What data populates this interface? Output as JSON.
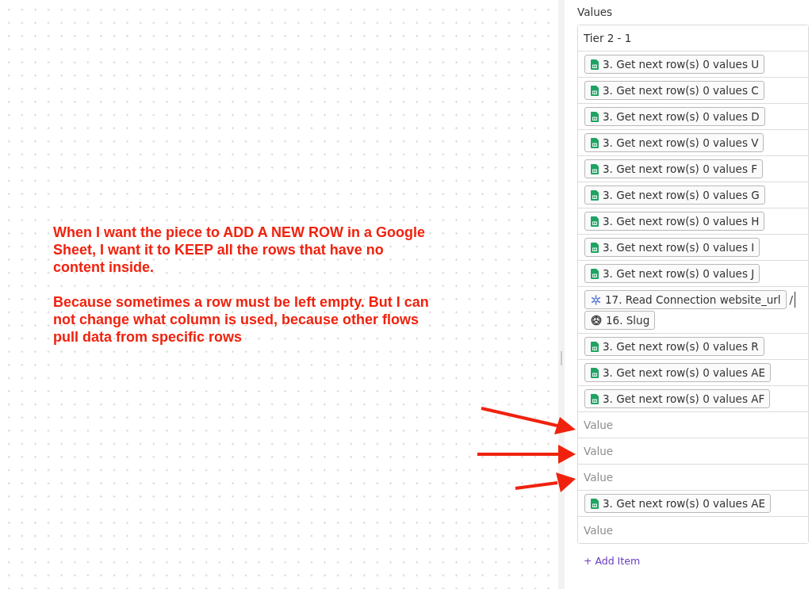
{
  "canvas": {
    "annotation": [
      "When I want the piece to ADD A NEW ROW in a Google Sheet, I want it to KEEP all the rows that have no content inside.",
      "Because sometimes a row must be left empty. But I can not change what column is used, because other flows pull data from specific rows"
    ]
  },
  "panel": {
    "label": "Values",
    "items": [
      {
        "kind": "text",
        "value": "Tier 2 - 1"
      },
      {
        "kind": "chips",
        "parts": [
          {
            "kind": "sheets",
            "text": "3. Get next row(s) 0 values U"
          }
        ]
      },
      {
        "kind": "chips",
        "parts": [
          {
            "kind": "sheets",
            "text": "3. Get next row(s) 0 values C"
          }
        ]
      },
      {
        "kind": "chips",
        "parts": [
          {
            "kind": "sheets",
            "text": "3. Get next row(s) 0 values D"
          }
        ]
      },
      {
        "kind": "chips",
        "parts": [
          {
            "kind": "sheets",
            "text": "3. Get next row(s) 0 values V"
          }
        ]
      },
      {
        "kind": "chips",
        "parts": [
          {
            "kind": "sheets",
            "text": "3. Get next row(s) 0 values F"
          }
        ]
      },
      {
        "kind": "chips",
        "parts": [
          {
            "kind": "sheets",
            "text": "3. Get next row(s) 0 values G"
          }
        ]
      },
      {
        "kind": "chips",
        "parts": [
          {
            "kind": "sheets",
            "text": "3. Get next row(s) 0 values H"
          }
        ]
      },
      {
        "kind": "chips",
        "parts": [
          {
            "kind": "sheets",
            "text": "3. Get next row(s) 0 values I"
          }
        ]
      },
      {
        "kind": "chips",
        "parts": [
          {
            "kind": "sheets",
            "text": "3. Get next row(s) 0 values J"
          }
        ]
      },
      {
        "kind": "chips",
        "parts": [
          {
            "kind": "connection",
            "text": "17. Read Connection website_url"
          },
          {
            "kind": "text",
            "text": "/"
          },
          {
            "kind": "ai",
            "text": "16. Slug"
          }
        ]
      },
      {
        "kind": "chips",
        "parts": [
          {
            "kind": "sheets",
            "text": "3. Get next row(s) 0 values R"
          }
        ]
      },
      {
        "kind": "chips",
        "parts": [
          {
            "kind": "sheets",
            "text": "3. Get next row(s) 0 values AE"
          }
        ]
      },
      {
        "kind": "chips",
        "parts": [
          {
            "kind": "sheets",
            "text": "3. Get next row(s) 0 values AF"
          }
        ]
      },
      {
        "kind": "empty",
        "placeholder": "Value"
      },
      {
        "kind": "empty",
        "placeholder": "Value"
      },
      {
        "kind": "empty",
        "placeholder": "Value"
      },
      {
        "kind": "chips",
        "parts": [
          {
            "kind": "sheets",
            "text": "3. Get next row(s) 0 values AE"
          }
        ]
      },
      {
        "kind": "empty",
        "placeholder": "Value"
      }
    ],
    "add_button": "+ Add Item"
  }
}
